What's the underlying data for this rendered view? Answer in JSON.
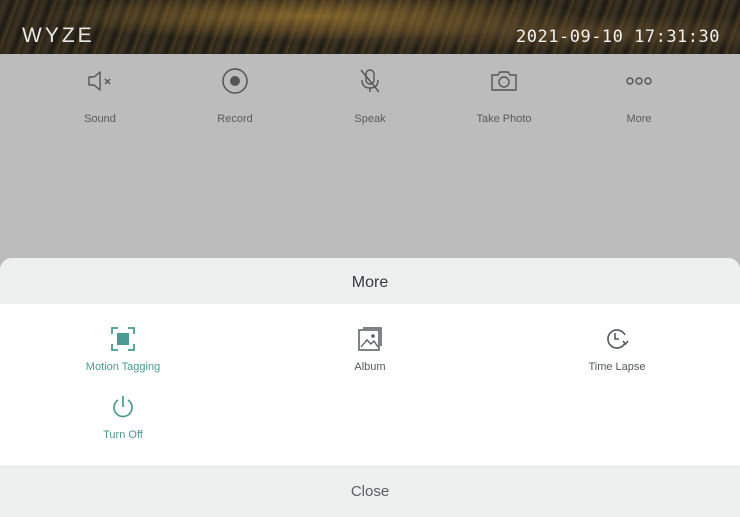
{
  "feed": {
    "logo": "WYZE",
    "timestamp": "2021-09-10 17:31:30"
  },
  "controls": [
    {
      "label": "Sound",
      "icon": "speaker-muted-icon"
    },
    {
      "label": "Record",
      "icon": "record-icon"
    },
    {
      "label": "Speak",
      "icon": "microphone-off-icon"
    },
    {
      "label": "Take Photo",
      "icon": "camera-icon"
    },
    {
      "label": "More",
      "icon": "more-dots-icon"
    }
  ],
  "sheet": {
    "title": "More",
    "options": [
      {
        "label": "Motion Tagging",
        "icon": "motion-tagging-icon",
        "active": true
      },
      {
        "label": "Album",
        "icon": "album-icon",
        "active": false
      },
      {
        "label": "Time Lapse",
        "icon": "time-lapse-icon",
        "active": false
      },
      {
        "label": "Turn Off",
        "icon": "power-icon",
        "active": true
      }
    ],
    "close_label": "Close"
  },
  "colors": {
    "accent": "#4a9a93",
    "inactive_text": "#555a5c",
    "dimmed_background": "#bcbcbc",
    "sheet_bar": "#eef0f0"
  }
}
